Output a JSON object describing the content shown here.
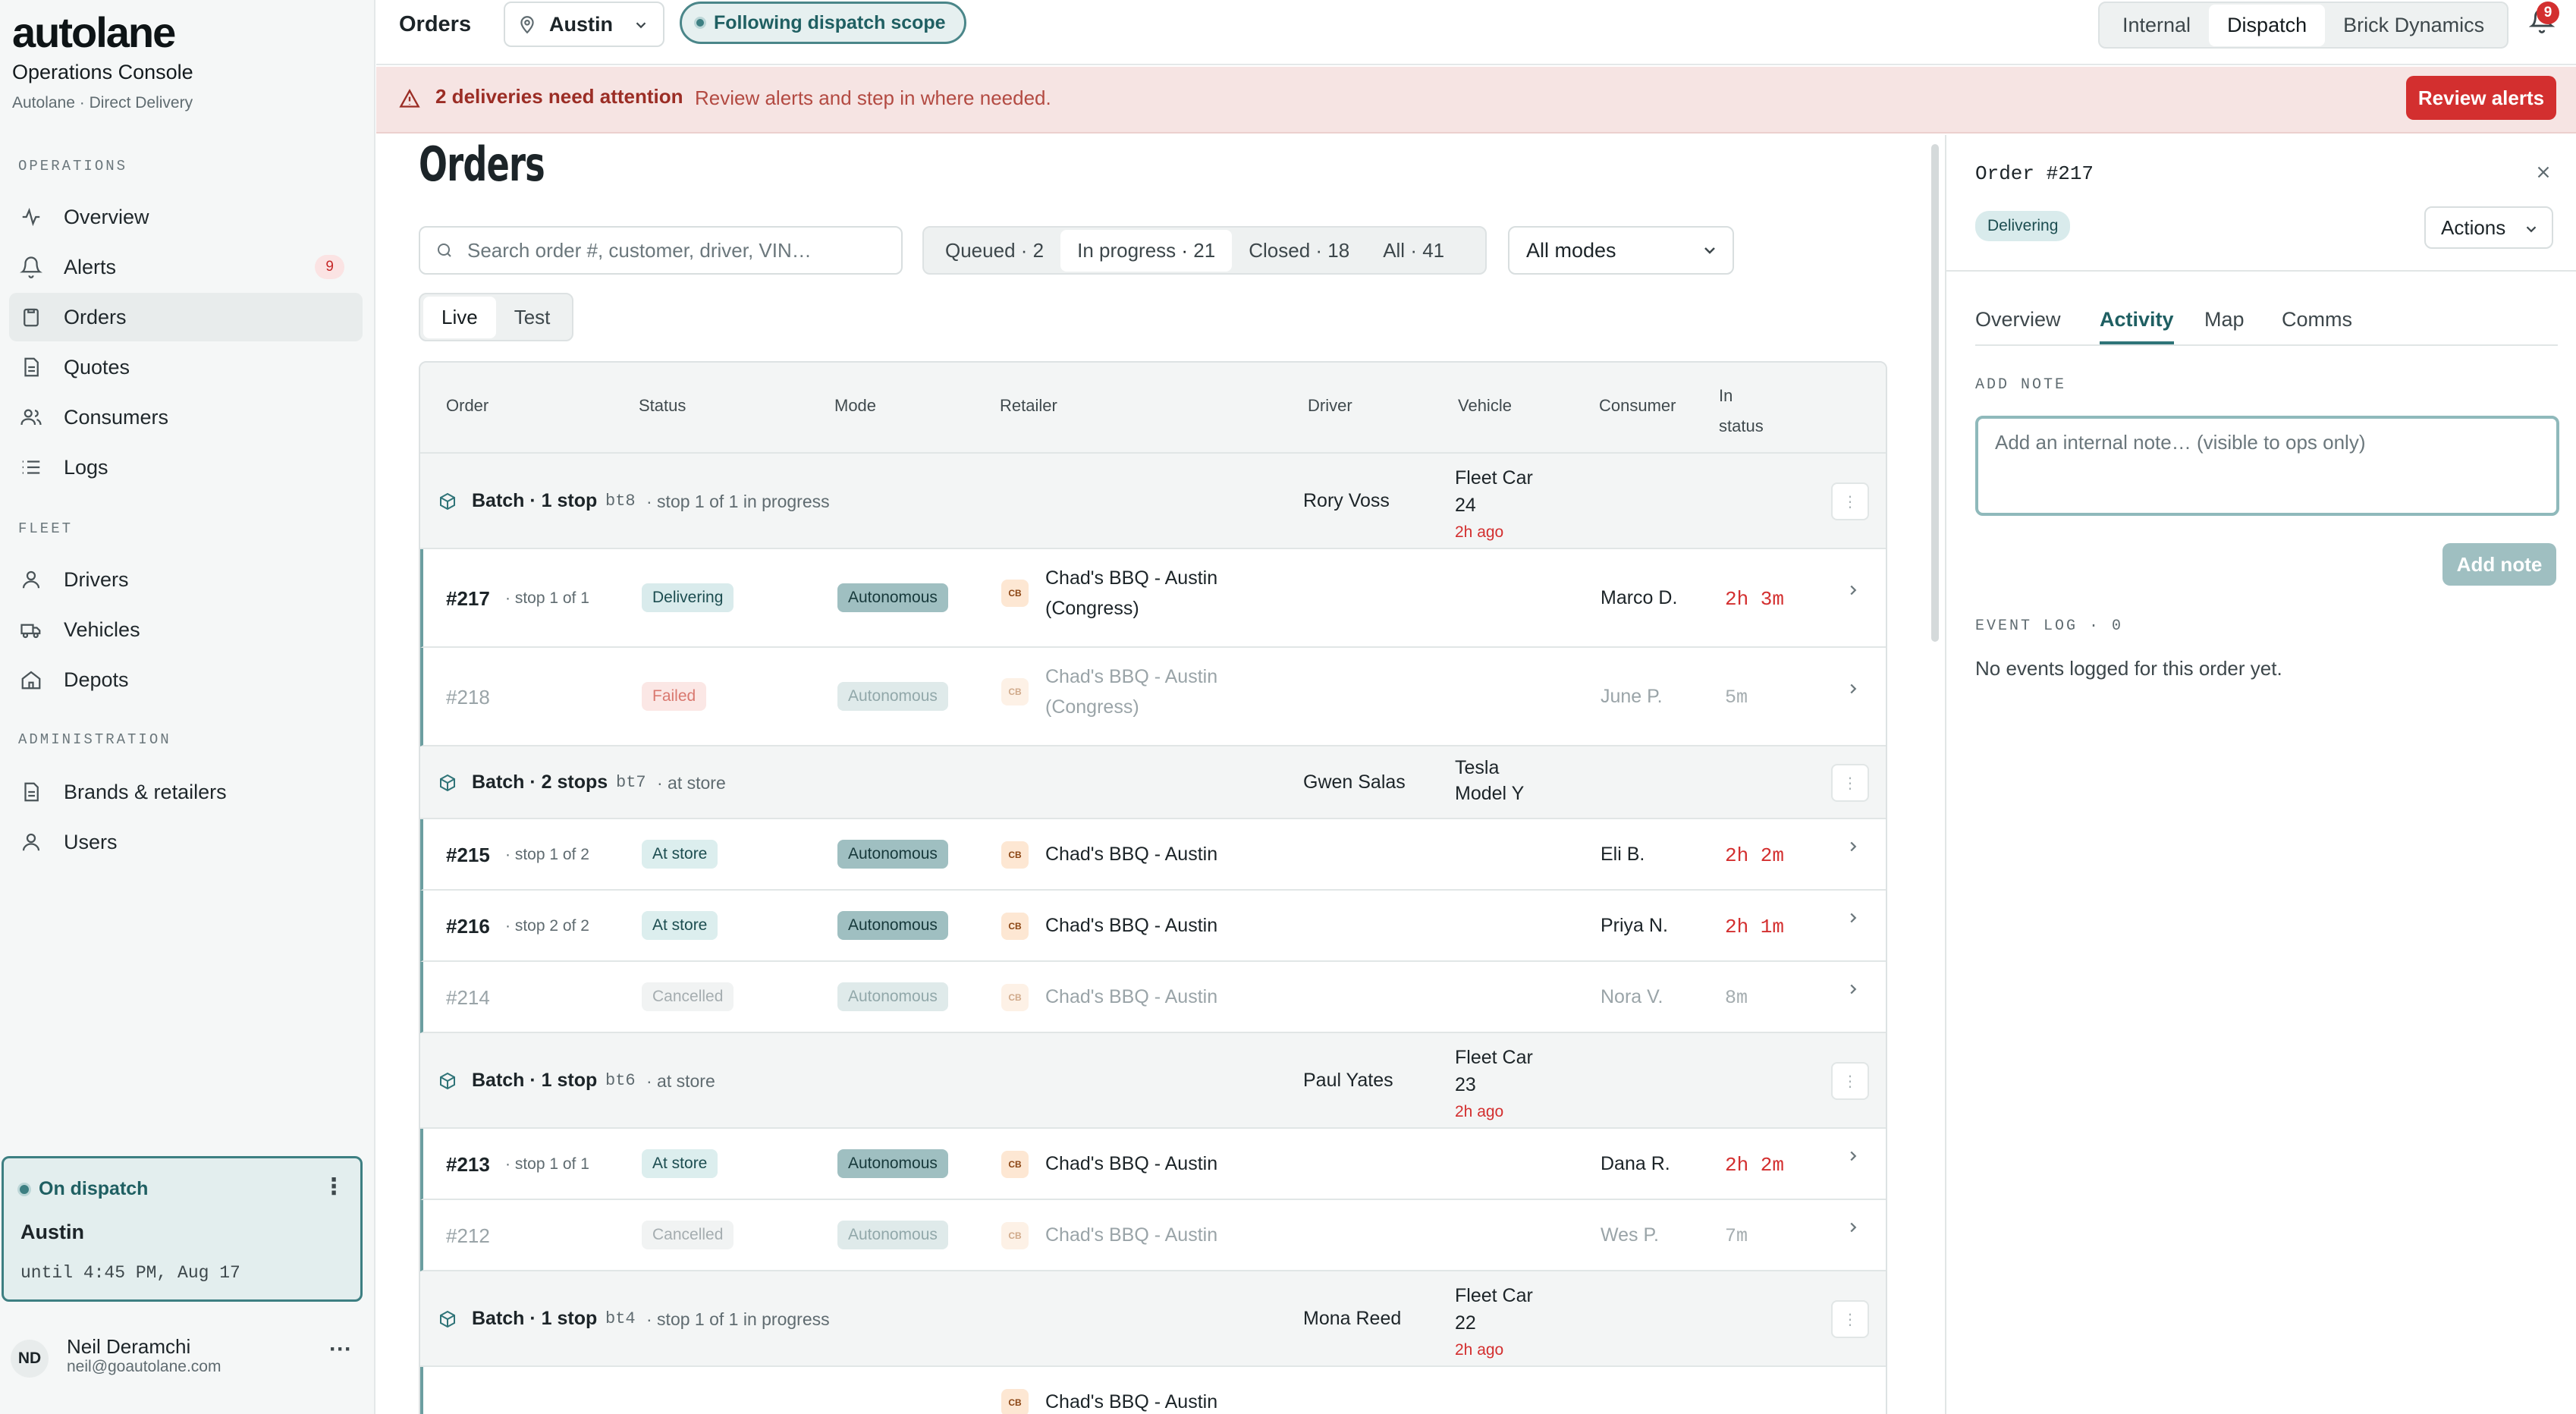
{
  "sidebar": {
    "logo": "autolane",
    "title": "Operations Console",
    "subtitle": "Autolane · Direct Delivery",
    "sections": [
      {
        "label": "OPERATIONS",
        "items": [
          {
            "label": "Overview",
            "icon": "activity-icon"
          },
          {
            "label": "Alerts",
            "icon": "bell-icon",
            "count": "9"
          },
          {
            "label": "Orders",
            "icon": "clipboard-icon",
            "active": true
          },
          {
            "label": "Quotes",
            "icon": "document-icon"
          },
          {
            "label": "Consumers",
            "icon": "users-icon"
          },
          {
            "label": "Logs",
            "icon": "list-icon"
          }
        ]
      },
      {
        "label": "FLEET",
        "items": [
          {
            "label": "Drivers",
            "icon": "user-icon"
          },
          {
            "label": "Vehicles",
            "icon": "truck-icon"
          },
          {
            "label": "Depots",
            "icon": "home-icon"
          }
        ]
      },
      {
        "label": "ADMINISTRATION",
        "items": [
          {
            "label": "Brands & retailers",
            "icon": "document-icon"
          },
          {
            "label": "Users",
            "icon": "user-icon"
          }
        ]
      }
    ],
    "dispatch": {
      "status": "On dispatch",
      "city": "Austin",
      "until": "until 4:45 PM, Aug 17"
    },
    "user": {
      "initials": "ND",
      "name": "Neil Deramchi",
      "email": "neil@goautolane.com"
    }
  },
  "topbar": {
    "title": "Orders",
    "city": "Austin",
    "scope": "Following dispatch scope",
    "views": [
      "Internal",
      "Dispatch",
      "Brick Dynamics"
    ],
    "active_view": "Dispatch",
    "notifications": "9"
  },
  "alert": {
    "headline": "2 deliveries need attention",
    "text": "Review alerts and step in where needed.",
    "button": "Review alerts"
  },
  "main": {
    "title": "Orders",
    "search_placeholder": "Search order #, customer, driver, VIN…",
    "filters": [
      {
        "label": "Queued",
        "count": "2"
      },
      {
        "label": "In progress",
        "count": "21",
        "active": true
      },
      {
        "label": "Closed",
        "count": "18"
      },
      {
        "label": "All",
        "count": "41"
      }
    ],
    "mode_select": "All modes",
    "env": [
      "Live",
      "Test"
    ],
    "active_env": "Live",
    "columns": [
      "Order",
      "Status",
      "Mode",
      "Retailer",
      "Driver",
      "Vehicle",
      "Consumer",
      "In status"
    ],
    "rows": [
      {
        "kind": "batch",
        "title": "Batch · 1 stop",
        "code": "bt8",
        "note": "· stop 1 of 1 in progress",
        "driver": "Rory Voss",
        "vehicle_line1": "Fleet Car",
        "vehicle_line2": "24",
        "ago": "2h ago"
      },
      {
        "kind": "order",
        "id": "#217",
        "stop": "· stop 1 of 1",
        "status": "Delivering",
        "mode": "Autonomous",
        "retailer_line1": "Chad's BBQ - Austin",
        "retailer_line2": "(Congress)",
        "consumer": "Marco D.",
        "time": "2h 3m",
        "dim": false
      },
      {
        "kind": "order",
        "id": "#218",
        "stop": "",
        "status": "Failed",
        "mode": "Autonomous",
        "retailer_line1": "Chad's BBQ - Austin",
        "retailer_line2": "(Congress)",
        "consumer": "June P.",
        "time": "5m",
        "dim": true
      },
      {
        "kind": "batch",
        "title": "Batch · 2 stops",
        "code": "bt7",
        "note": "· at store",
        "driver": "Gwen Salas",
        "vehicle_line1": "Tesla",
        "vehicle_line2": "Model Y",
        "ago": ""
      },
      {
        "kind": "order",
        "id": "#215",
        "stop": "· stop 1 of 2",
        "status": "At store",
        "mode": "Autonomous",
        "retailer_line1": "Chad's BBQ - Austin",
        "retailer_line2": "",
        "consumer": "Eli B.",
        "time": "2h 2m",
        "dim": false
      },
      {
        "kind": "order",
        "id": "#216",
        "stop": "· stop 2 of 2",
        "status": "At store",
        "mode": "Autonomous",
        "retailer_line1": "Chad's BBQ - Austin",
        "retailer_line2": "",
        "consumer": "Priya N.",
        "time": "2h 1m",
        "dim": false
      },
      {
        "kind": "order",
        "id": "#214",
        "stop": "",
        "status": "Cancelled",
        "mode": "Autonomous",
        "retailer_line1": "Chad's BBQ - Austin",
        "retailer_line2": "",
        "consumer": "Nora V.",
        "time": "8m",
        "dim": true
      },
      {
        "kind": "batch",
        "title": "Batch · 1 stop",
        "code": "bt6",
        "note": "· at store",
        "driver": "Paul Yates",
        "vehicle_line1": "Fleet Car",
        "vehicle_line2": "23",
        "ago": "2h ago"
      },
      {
        "kind": "order",
        "id": "#213",
        "stop": "· stop 1 of 1",
        "status": "At store",
        "mode": "Autonomous",
        "retailer_line1": "Chad's BBQ - Austin",
        "retailer_line2": "",
        "consumer": "Dana R.",
        "time": "2h 2m",
        "dim": false
      },
      {
        "kind": "order",
        "id": "#212",
        "stop": "",
        "status": "Cancelled",
        "mode": "Autonomous",
        "retailer_line1": "Chad's BBQ - Austin",
        "retailer_line2": "",
        "consumer": "Wes P.",
        "time": "7m",
        "dim": true
      },
      {
        "kind": "batch",
        "title": "Batch · 1 stop",
        "code": "bt4",
        "note": "· stop 1 of 1 in progress",
        "driver": "Mona Reed",
        "vehicle_line1": "Fleet Car",
        "vehicle_line2": "22",
        "ago": "2h ago"
      },
      {
        "kind": "order",
        "id": "",
        "stop": "",
        "status": "",
        "mode": "",
        "retailer_line1": "Chad's BBQ - Austin",
        "retailer_line2": "",
        "consumer": "",
        "time": "",
        "dim": false
      }
    ],
    "retailer_logo": "CB"
  },
  "panel": {
    "title": "Order #217",
    "status": "Delivering",
    "actions": "Actions",
    "tabs": [
      "Overview",
      "Activity",
      "Map",
      "Comms"
    ],
    "active_tab": "Activity",
    "add_note_label": "ADD NOTE",
    "note_placeholder": "Add an internal note… (visible to ops only)",
    "add_note_button": "Add note",
    "event_log_label": "EVENT LOG · 0",
    "empty_text": "No events logged for this order yet."
  }
}
